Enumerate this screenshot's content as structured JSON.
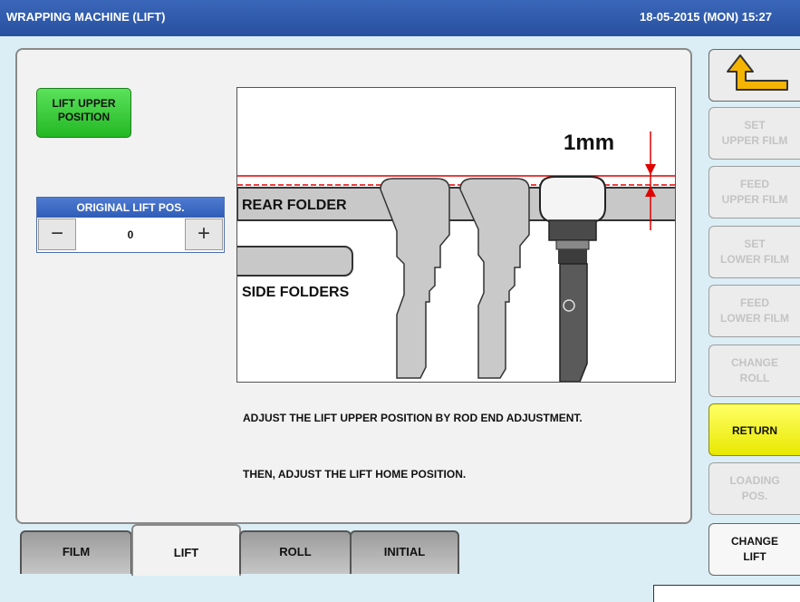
{
  "titlebar": {
    "title": "WRAPPING MACHINE (LIFT)",
    "datetime": "18-05-2015 (MON)  15:27"
  },
  "lift_upper_button": {
    "line1": "LIFT UPPER",
    "line2": "POSITION"
  },
  "original_lift": {
    "header": "ORIGINAL LIFT POS.",
    "value": "0",
    "minus": "−",
    "plus": "+"
  },
  "illustration": {
    "gap_label": "1mm",
    "rear_label": "REAR FOLDER",
    "side_label": "SIDE FOLDERS"
  },
  "instructions": {
    "line1": "ADJUST THE LIFT UPPER POSITION BY ROD END ADJUSTMENT.",
    "line2": "THEN, ADJUST THE LIFT HOME POSITION."
  },
  "tabs": [
    {
      "label": "FILM"
    },
    {
      "label": "LIFT",
      "active": true
    },
    {
      "label": "ROLL"
    },
    {
      "label": "INITIAL"
    }
  ],
  "side_buttons": {
    "back_icon": "back-arrow-icon",
    "set_upper_film": [
      "SET",
      "UPPER FILM"
    ],
    "feed_upper_film": [
      "FEED",
      "UPPER FILM"
    ],
    "set_lower_film": [
      "SET",
      "LOWER FILM"
    ],
    "feed_lower_film": [
      "FEED",
      "LOWER FILM"
    ],
    "change_roll": [
      "CHANGE",
      "ROLL"
    ],
    "return": "RETURN",
    "loading_pos": [
      "LOADING",
      "POS."
    ],
    "change_lift": [
      "CHANGE",
      "LIFT"
    ]
  },
  "colors": {
    "title_bar": "#2f5db6",
    "green_button": "#33cc33",
    "return_button": "#ffff33",
    "dimension_marker": "#e00000"
  }
}
